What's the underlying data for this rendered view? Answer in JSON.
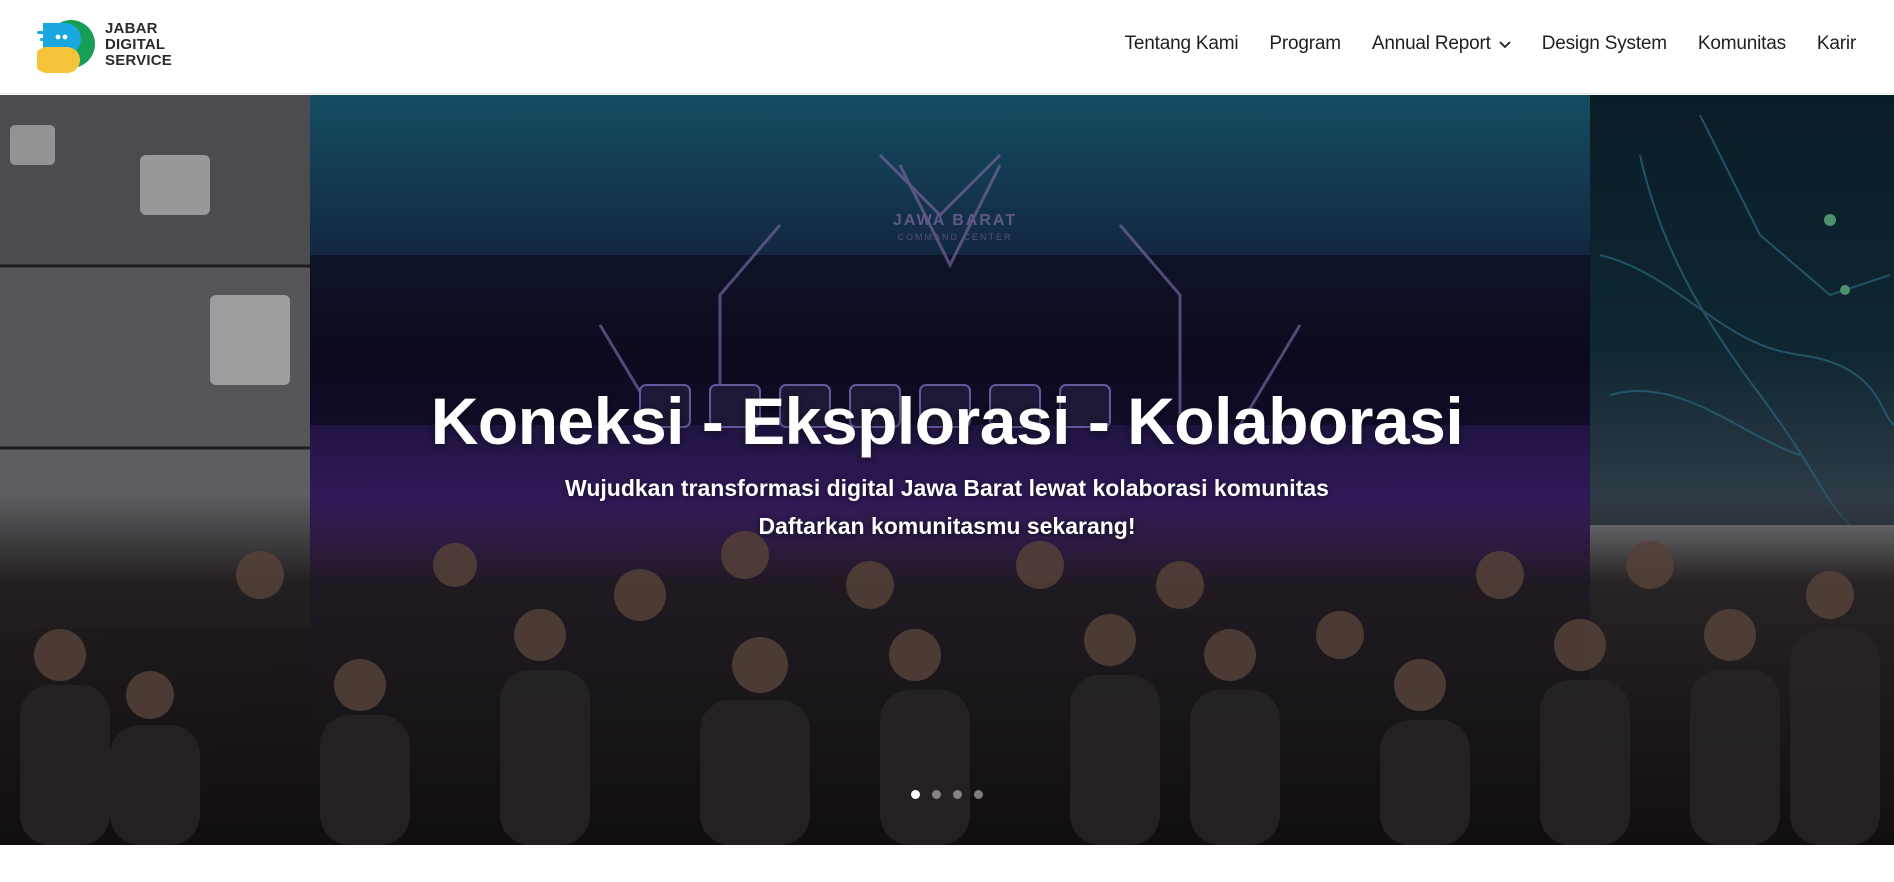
{
  "brand": {
    "line1": "JABAR",
    "line2": "DIGITAL",
    "line3": "SERVICE",
    "colors": {
      "blue": "#1aa7e0",
      "green": "#17a055",
      "yellow": "#f6c43b"
    }
  },
  "nav": {
    "items": [
      {
        "label": "Tentang Kami"
      },
      {
        "label": "Program"
      },
      {
        "label": "Annual Report",
        "icon": "chevron-down-icon"
      },
      {
        "label": "Design System"
      },
      {
        "label": "Komunitas"
      },
      {
        "label": "Karir"
      }
    ]
  },
  "hero": {
    "title": "Koneksi - Eksplorasi - Kolaborasi",
    "subtitle_line1": "Wujudkan transformasi digital Jawa Barat lewat kolaborasi komunitas",
    "subtitle_line2": "Daftarkan komunitasmu sekarang!",
    "screen_label": "JAWA BARAT",
    "screen_sublabel": "COMMAND CENTER",
    "slides": {
      "count": 4,
      "active": 1
    }
  }
}
